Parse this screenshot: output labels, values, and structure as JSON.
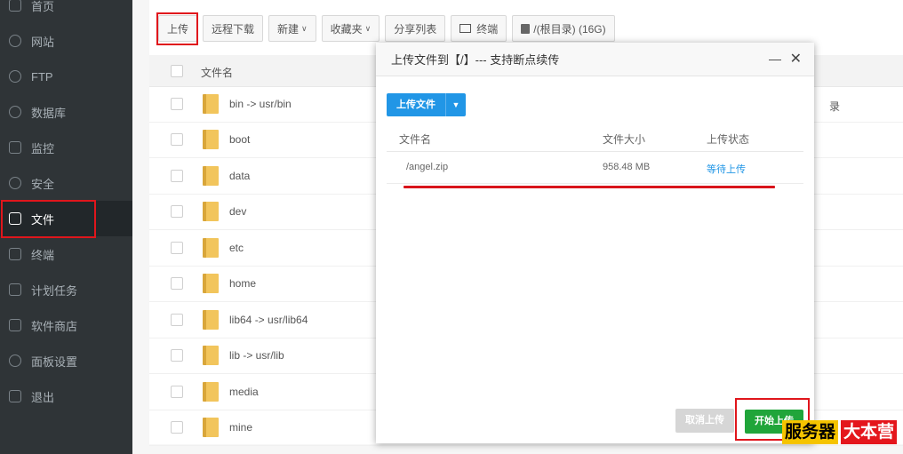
{
  "sidebar": {
    "items": [
      {
        "label": "首页",
        "icon": "home-icon"
      },
      {
        "label": "网站",
        "icon": "globe-icon"
      },
      {
        "label": "FTP",
        "icon": "user-icon"
      },
      {
        "label": "数据库",
        "icon": "database-icon"
      },
      {
        "label": "监控",
        "icon": "monitor-icon"
      },
      {
        "label": "安全",
        "icon": "shield-icon"
      },
      {
        "label": "文件",
        "icon": "folder-icon"
      },
      {
        "label": "终端",
        "icon": "terminal-icon"
      },
      {
        "label": "计划任务",
        "icon": "calendar-icon"
      },
      {
        "label": "软件商店",
        "icon": "grid-icon"
      },
      {
        "label": "面板设置",
        "icon": "gear-icon"
      },
      {
        "label": "退出",
        "icon": "logout-icon"
      }
    ],
    "active": "文件"
  },
  "toolbar": {
    "upload": "上传",
    "remote_download": "远程下载",
    "new": "新建",
    "favorites": "收藏夹",
    "share_list": "分享列表",
    "terminal": "终端",
    "disk": "/(根目录) (16G)"
  },
  "file_table": {
    "header_name": "文件名",
    "rows": [
      "bin -> usr/bin",
      "boot",
      "data",
      "dev",
      "etc",
      "home",
      "lib64 -> usr/lib64",
      "lib -> usr/lib",
      "media",
      "mine"
    ],
    "peek_text": "录"
  },
  "modal": {
    "title": "上传文件到【/】--- 支持断点续传",
    "minimize": "—",
    "close": "✕",
    "upload_file_button": "上传文件",
    "columns": {
      "name": "文件名",
      "size": "文件大小",
      "status": "上传状态"
    },
    "file": {
      "name": "/angel.zip",
      "size": "958.48 MB",
      "status": "等待上传"
    },
    "cancel_button": "取消上传",
    "start_button": "开始上传"
  },
  "watermark": {
    "part1": "服务器",
    "part2": "大本营"
  },
  "colors": {
    "sidebar_bg": "#2f3437",
    "accent_blue": "#2196e6",
    "accent_green": "#20a53a",
    "highlight_red": "#e0161c"
  }
}
